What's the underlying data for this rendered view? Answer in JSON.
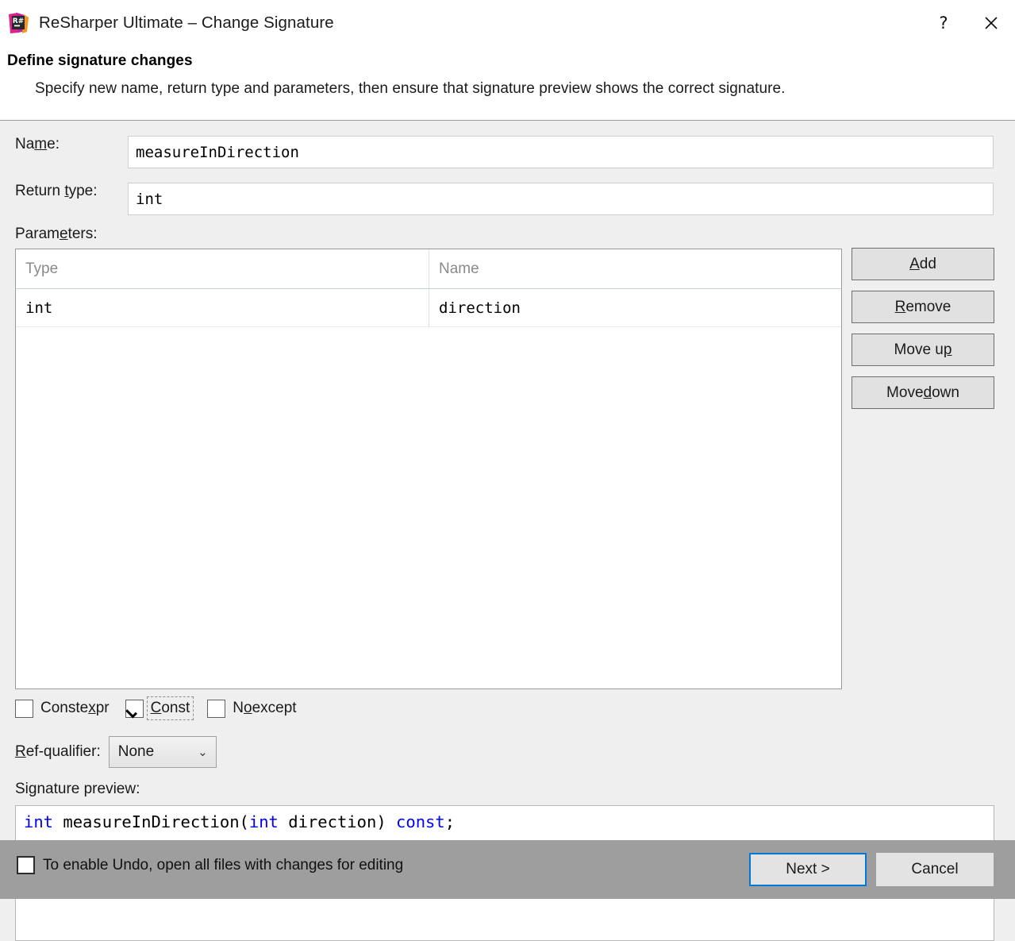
{
  "window": {
    "icon": "resharper-logo-icon",
    "title": "ReSharper Ultimate – Change Signature",
    "help_label": "?",
    "close_label": "✕"
  },
  "header": {
    "title": "Define signature changes",
    "subtitle": "Specify new name, return type and parameters, then ensure that signature preview shows the correct signature."
  },
  "form": {
    "name": {
      "label_before": "Na",
      "label_mnemonic": "m",
      "label_after": "e:",
      "value": "measureInDirection",
      "placeholder": ""
    },
    "return_type": {
      "label_before": "Return ",
      "label_mnemonic": "t",
      "label_after": "ype:",
      "value": "int",
      "placeholder": ""
    },
    "parameters": {
      "label_before": "Param",
      "label_mnemonic": "e",
      "label_after": "ters:",
      "columns": [
        "Type",
        "Name"
      ],
      "rows": [
        {
          "type": "int",
          "name": "direction"
        }
      ]
    },
    "side_buttons": [
      {
        "before": "",
        "mnemonic": "A",
        "after": "dd",
        "name": "add-button"
      },
      {
        "before": "",
        "mnemonic": "R",
        "after": "emove",
        "name": "remove-button"
      },
      {
        "before": "Move u",
        "mnemonic": "p",
        "after": "",
        "name": "move-up-button"
      },
      {
        "before": "Move ",
        "mnemonic": "d",
        "after": "own",
        "name": "move-down-button"
      }
    ],
    "options": [
      {
        "before": "Conste",
        "mnemonic": "x",
        "after": "pr",
        "checked": false,
        "focused": false,
        "name": "constexpr"
      },
      {
        "before": "",
        "mnemonic": "C",
        "after": "onst",
        "checked": true,
        "focused": true,
        "name": "const"
      },
      {
        "before": "N",
        "mnemonic": "o",
        "after": "except",
        "checked": false,
        "focused": false,
        "name": "noexcept"
      }
    ],
    "ref_qualifier": {
      "label_before": "",
      "label_mnemonic": "R",
      "label_after": "ef-qualifier:",
      "value": "None",
      "options": [
        "None",
        "&",
        "&&"
      ]
    },
    "signature_preview": {
      "label": "Signature preview:",
      "tokens": [
        {
          "text": "int",
          "kind": "keyword"
        },
        {
          "text": " measureInDirection(",
          "kind": "plain"
        },
        {
          "text": "int",
          "kind": "keyword"
        },
        {
          "text": " direction) ",
          "kind": "plain"
        },
        {
          "text": "const",
          "kind": "keyword"
        },
        {
          "text": ";",
          "kind": "plain"
        }
      ],
      "text": "int measureInDirection(int direction) const;"
    }
  },
  "footer": {
    "undo_checkbox": {
      "label": "To enable Undo, open all files with changes for editing",
      "checked": false
    },
    "next_label": "Next >",
    "cancel_label": "Cancel"
  },
  "colors": {
    "dialog_bg": "#efefef",
    "header_bg": "#ffffff",
    "footer_bg": "#9e9e9e",
    "accent_focus": "#0078d7",
    "keyword_blue": "#0000ff",
    "placeholder_grey": "#8a8a8a",
    "logo_pink": "#e0218a",
    "logo_magenta": "#c3219c",
    "logo_orange": "#f7981d",
    "logo_dark": "#25282d"
  }
}
